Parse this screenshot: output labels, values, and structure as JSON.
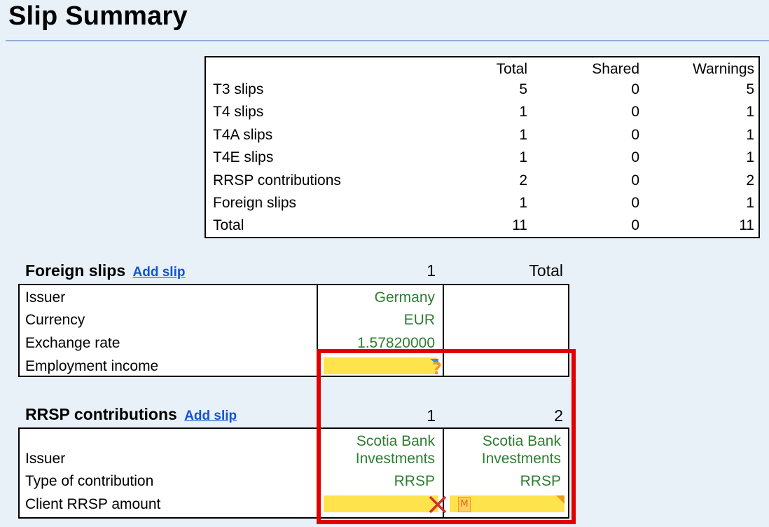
{
  "page": {
    "title": "Slip Summary"
  },
  "summary": {
    "headers": {
      "total": "Total",
      "shared": "Shared",
      "warnings": "Warnings"
    },
    "rows": [
      {
        "label": "T3 slips",
        "total": "5",
        "shared": "0",
        "warnings": "5"
      },
      {
        "label": "T4 slips",
        "total": "1",
        "shared": "0",
        "warnings": "1"
      },
      {
        "label": "T4A slips",
        "total": "1",
        "shared": "0",
        "warnings": "1"
      },
      {
        "label": "T4E slips",
        "total": "1",
        "shared": "0",
        "warnings": "1"
      },
      {
        "label": "RRSP contributions",
        "total": "2",
        "shared": "0",
        "warnings": "2"
      },
      {
        "label": "Foreign slips",
        "total": "1",
        "shared": "0",
        "warnings": "1"
      },
      {
        "label": "Total",
        "total": "11",
        "shared": "0",
        "warnings": "11"
      }
    ]
  },
  "foreign": {
    "title": "Foreign slips",
    "add_link": "Add slip",
    "col1": "1",
    "col2": "Total",
    "rows": {
      "issuer": {
        "label": "Issuer",
        "value": "Germany"
      },
      "currency": {
        "label": "Currency",
        "value": "EUR"
      },
      "exchange": {
        "label": "Exchange rate",
        "value": "1.57820000"
      },
      "employment": {
        "label": "Employment income",
        "value": ""
      }
    },
    "question_icon": "?"
  },
  "rrsp": {
    "title": "RRSP contributions",
    "add_link": "Add slip",
    "col1": "1",
    "col2": "2",
    "rows": {
      "issuer": {
        "label": "Issuer",
        "value1_line1": "Scotia Bank",
        "value1_line2": "Investments",
        "value2_line1": "Scotia Bank",
        "value2_line2": "Investments"
      },
      "type": {
        "label": "Type of contribution",
        "value1": "RRSP",
        "value2": "RRSP"
      },
      "amount": {
        "label": "Client RRSP amount"
      }
    },
    "m_icon": "M"
  },
  "colors": {
    "accent_green": "#2e7d32",
    "link_blue": "#1155cc",
    "field_yellow": "#ffe34d",
    "highlight_red": "#e00000"
  }
}
